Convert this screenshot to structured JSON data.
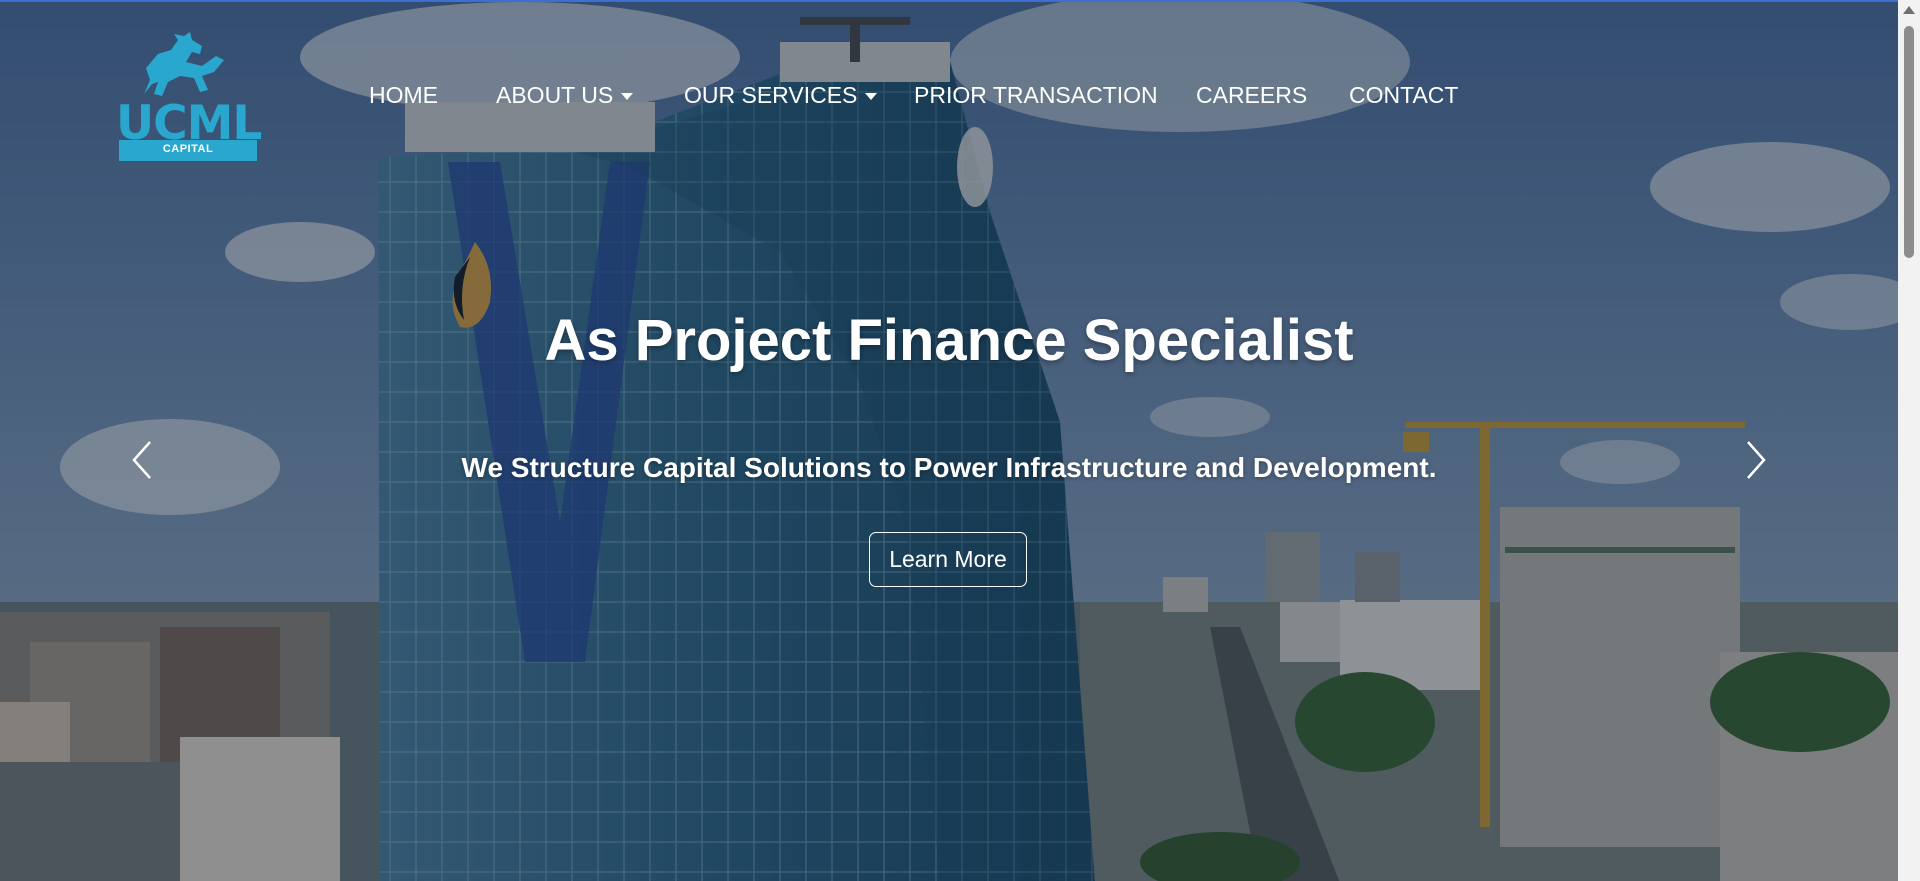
{
  "logo": {
    "wordmark": "UCML",
    "subtitle": "CAPITAL"
  },
  "nav": {
    "items": [
      {
        "label": "HOME",
        "has_dropdown": false
      },
      {
        "label": "ABOUT US",
        "has_dropdown": true
      },
      {
        "label": "OUR SERVICES",
        "has_dropdown": true
      },
      {
        "label": "PRIOR TRANSACTION",
        "has_dropdown": false
      },
      {
        "label": "CAREERS",
        "has_dropdown": false
      },
      {
        "label": "CONTACT",
        "has_dropdown": false
      }
    ]
  },
  "hero": {
    "headline": "As Project Finance Specialist",
    "subheadline": "We Structure Capital Solutions to Power Infrastructure and Development.",
    "cta_label": "Learn More",
    "prev_icon": "chevron-left-icon",
    "next_icon": "chevron-right-icon"
  },
  "colors": {
    "brand": "#2aa7cf",
    "text": "#ffffff",
    "overlay": "#0a1423"
  }
}
